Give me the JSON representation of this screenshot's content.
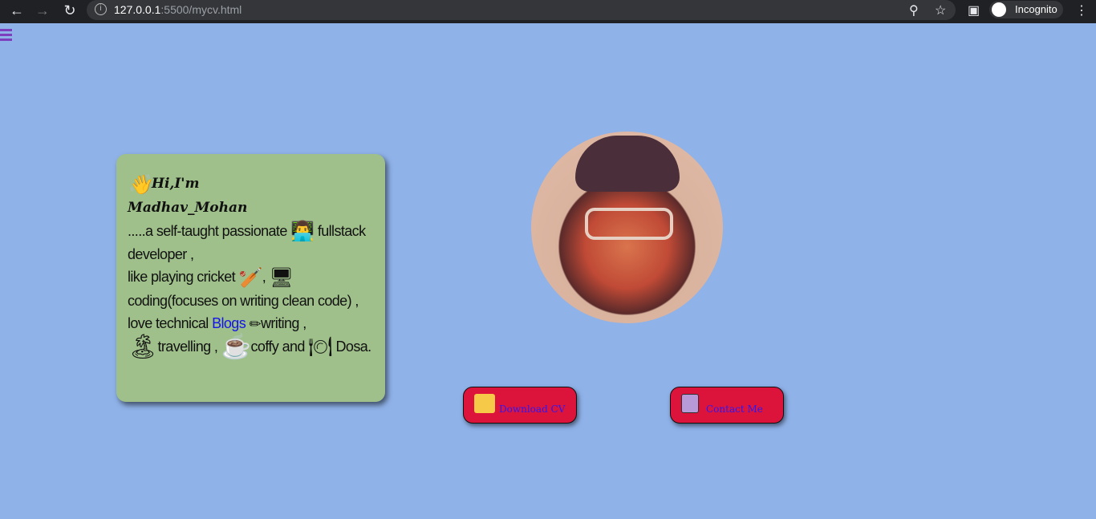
{
  "browser": {
    "url_host": "127.0.0.1",
    "url_rest": ":5500/mycv.html",
    "profile": "Incognito"
  },
  "card": {
    "greeting": "Hi,I'm",
    "name": "Madhav_Mohan",
    "line1": ".....a self-taught passionate",
    "line1b": "fullstack developer ,",
    "line2": "like playing cricket",
    "line2b": ",",
    "line3": "coding(focuses on writing clean code) ,",
    "line4a": "love technical",
    "blogs_link": "Blogs",
    "line4b": "writing ,",
    "line5a": "travelling ,",
    "line5b": "coffy and",
    "line5c": "Dosa."
  },
  "buttons": {
    "download": "Download CV",
    "contact": "Contact Me"
  },
  "colors": {
    "page_bg": "#8fb2e9",
    "card_bg": "#9fc08a",
    "button_bg": "#dc143c",
    "button_text": "#2a18f5"
  }
}
